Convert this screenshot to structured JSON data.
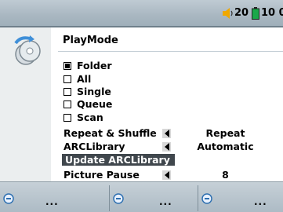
{
  "status": {
    "volume": "20",
    "battery": "10 0"
  },
  "panel": {
    "title": "PlayMode",
    "options": [
      {
        "label": "Folder",
        "checked": true
      },
      {
        "label": "All",
        "checked": false
      },
      {
        "label": "Single",
        "checked": false
      },
      {
        "label": "Queue",
        "checked": false
      },
      {
        "label": "Scan",
        "checked": false
      }
    ],
    "rows": [
      {
        "label": "Repeat & Shuffle",
        "value": "Repeat"
      },
      {
        "label": "ARCLibrary",
        "value": "Automatic"
      },
      {
        "label": "Update ARCLibrary",
        "value": ""
      },
      {
        "label": "Picture Pause",
        "value": "8"
      }
    ]
  },
  "softkeys": [
    {
      "label": "..."
    },
    {
      "label": "..."
    },
    {
      "label": "..."
    }
  ],
  "colors": {
    "selection": "#40474d",
    "statusbar": "#a9b7c1",
    "battery": "#1aa84a"
  }
}
